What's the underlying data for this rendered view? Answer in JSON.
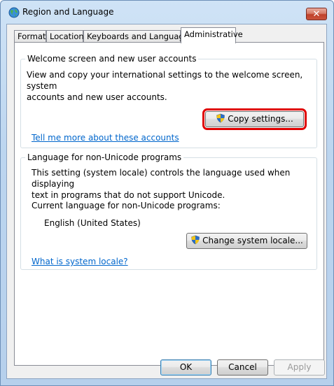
{
  "window": {
    "title": "Region and Language",
    "close_glyph": "✕"
  },
  "tabs": [
    {
      "label": "Formats"
    },
    {
      "label": "Location"
    },
    {
      "label": "Keyboards and Languages"
    },
    {
      "label": "Administrative",
      "active": true
    }
  ],
  "welcome_group": {
    "title": "Welcome screen and new user accounts",
    "description_line1": "View and copy your international settings to the welcome screen, system",
    "description_line2": "accounts and new user accounts.",
    "copy_button": "Copy settings...",
    "link": "Tell me more about these accounts"
  },
  "locale_group": {
    "title": "Language for non-Unicode programs",
    "description_line1": "This setting (system locale) controls the language used when displaying",
    "description_line2": "text in programs that do not support Unicode.",
    "current_label": "Current language for non-Unicode programs:",
    "current_value": "English (United States)",
    "change_button": "Change system locale...",
    "link": "What is system locale?"
  },
  "footer": {
    "ok": "OK",
    "cancel": "Cancel",
    "apply": "Apply"
  },
  "colors": {
    "link": "#0066cc",
    "highlight": "#e00000",
    "shield_blue": "#2a6fc9",
    "shield_yellow": "#f2c417"
  },
  "icons": {
    "app": "globe-icon",
    "shield": "uac-shield-icon"
  }
}
